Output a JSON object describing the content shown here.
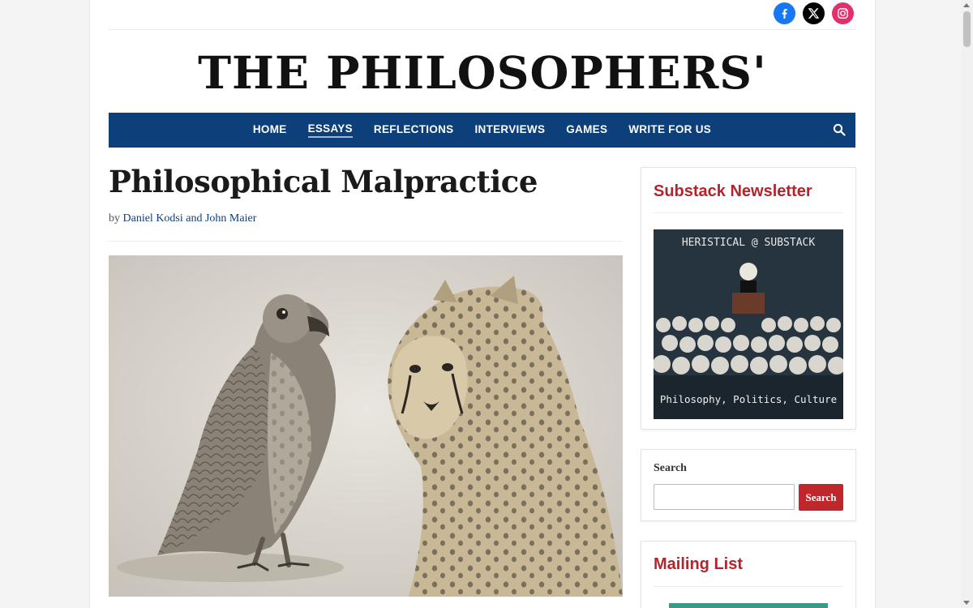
{
  "header": {
    "masthead": "THE PHILOSOPHERS' MAGAZINE",
    "social": [
      "facebook-icon",
      "x-icon",
      "instagram-icon"
    ]
  },
  "nav": {
    "items": [
      {
        "label": "HOME"
      },
      {
        "label": "ESSAYS"
      },
      {
        "label": "REFLECTIONS"
      },
      {
        "label": "INTERVIEWS"
      },
      {
        "label": "GAMES"
      },
      {
        "label": "WRITE FOR US"
      }
    ],
    "active": "ESSAYS"
  },
  "article": {
    "title": "Philosophical Malpractice",
    "by": "by",
    "authors": "Daniel Kodsi and John Maier"
  },
  "sidebar": {
    "substack": {
      "title": "Substack Newsletter",
      "image_text_top": "HERISTICAL @ SUBSTACK",
      "image_text_bottom": "Philosophy, Politics, Culture"
    },
    "search": {
      "label": "Search",
      "placeholder": "",
      "button": "Search"
    },
    "mailing": {
      "title": "Mailing List"
    }
  },
  "colors": {
    "nav_bg": "#0d3f7b",
    "accent_red": "#b3242c",
    "button_red": "#c0272d",
    "link_blue": "#0d3f7b"
  }
}
